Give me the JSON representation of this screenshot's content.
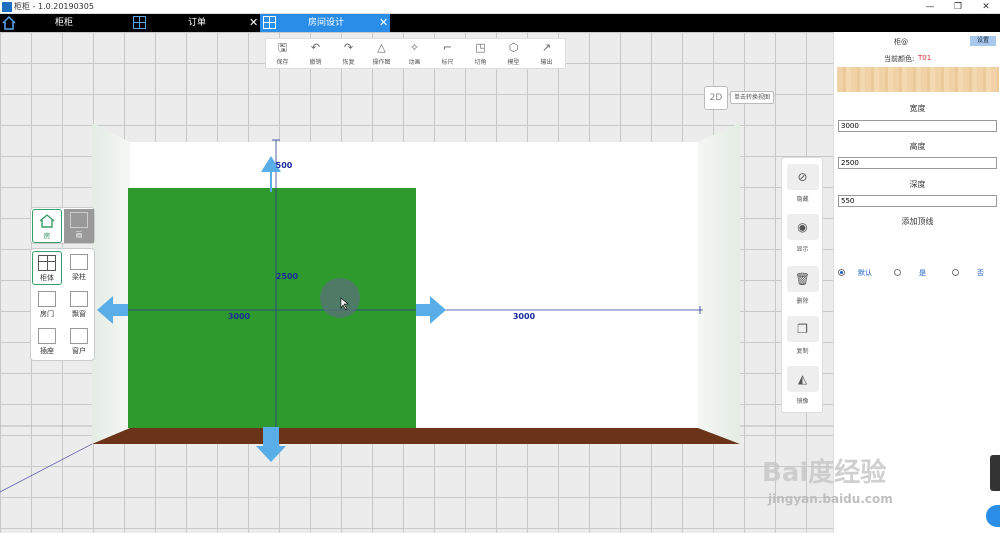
{
  "window": {
    "title": "柜柜 - 1.0.20190305",
    "minimize": "—",
    "maximize": "❐",
    "close": "✕"
  },
  "tabs": [
    {
      "label": "柜柜"
    },
    {
      "label": "订单",
      "close": "✕"
    },
    {
      "label": "房间设计",
      "close": "✕"
    }
  ],
  "toolbar": {
    "items": [
      {
        "label": "保存",
        "icon": "save-icon",
        "glyph": "🖫"
      },
      {
        "label": "撤销",
        "icon": "undo-icon",
        "glyph": "↶"
      },
      {
        "label": "恢复",
        "icon": "redo-icon",
        "glyph": "↷"
      },
      {
        "label": "操作图",
        "icon": "triangle-icon",
        "glyph": "△"
      },
      {
        "label": "动画",
        "icon": "sparkle-icon",
        "glyph": "✧"
      },
      {
        "label": "标尺",
        "icon": "ruler-icon",
        "glyph": "⌐"
      },
      {
        "label": "切角",
        "icon": "chamfer-icon",
        "glyph": "◳"
      },
      {
        "label": "模型",
        "icon": "cube-icon",
        "glyph": "⬡"
      },
      {
        "label": "输出",
        "icon": "export-icon",
        "glyph": "↗"
      }
    ]
  },
  "view": {
    "mode_button": "2D",
    "mode_tip": "单击转换视图"
  },
  "palette": {
    "top": [
      {
        "label": "房",
        "icon": "house-icon"
      },
      {
        "label": "画",
        "icon": "pen-icon"
      }
    ],
    "bottom": [
      {
        "label": "柜体",
        "icon": "cabinet-icon"
      },
      {
        "label": "梁柱",
        "icon": "beam-icon"
      },
      {
        "label": "房门",
        "icon": "door-icon"
      },
      {
        "label": "飘窗",
        "icon": "bay-window-icon"
      },
      {
        "label": "插座",
        "icon": "socket-icon"
      },
      {
        "label": "窗户",
        "icon": "window-icon"
      }
    ]
  },
  "right_tools": [
    {
      "label": "隐藏",
      "icon": "eye-off-icon",
      "glyph": "⊘"
    },
    {
      "label": "显示",
      "icon": "eye-icon",
      "glyph": "◉"
    },
    {
      "label": "删除",
      "icon": "trash-icon",
      "glyph": "🗑"
    },
    {
      "label": "复制",
      "icon": "copy-icon",
      "glyph": "❐"
    },
    {
      "label": "镜像",
      "icon": "mirror-icon",
      "glyph": "◭"
    }
  ],
  "dimensions": {
    "width_left": "3000",
    "width_right": "3000",
    "height": "2500",
    "top": "500"
  },
  "panel": {
    "title": "柜@",
    "settings_button": "设置",
    "color_label": "当前颜色:",
    "color_value": "T01",
    "width_label": "宽度",
    "width_value": "3000",
    "height_label": "高度",
    "height_value": "2500",
    "depth_label": "深度",
    "depth_value": "550",
    "topline_label": "添加顶线",
    "topline_options": [
      "默认",
      "是",
      "否"
    ],
    "topline_selected": "默认"
  },
  "watermark": {
    "logo": "Bai度经验",
    "url": "jingyan.baidu.com"
  },
  "colors": {
    "accent": "#2a8ee8",
    "cabinet": "#2e9a2e",
    "floor": "#6b3418",
    "arrow": "#5aaee8",
    "dim_line": "#2a3a9a"
  }
}
